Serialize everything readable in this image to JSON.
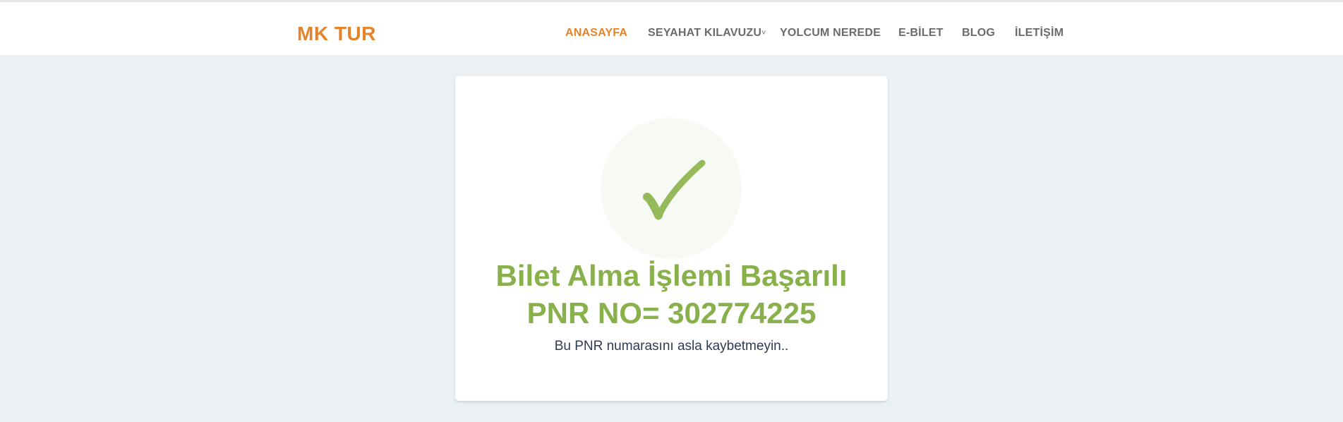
{
  "header": {
    "brand": "MK TUR",
    "nav": [
      {
        "label": "ANASAYFA",
        "active": true
      },
      {
        "label": "SEYAHAT KILAVUZU",
        "has_dropdown": true
      },
      {
        "label": "YOLCUM NEREDE"
      },
      {
        "label": "E-BİLET"
      },
      {
        "label": "BLOG"
      },
      {
        "label": "İLETİŞİM"
      }
    ]
  },
  "result": {
    "icon": "checkmark-icon",
    "title_line1": "Bilet Alma İşlemi Başarılı",
    "title_line2": "PNR NO= 302774225",
    "message": "Bu PNR numarasını asla kaybetmeyin.."
  },
  "colors": {
    "accent": "#e5832a",
    "success": "#88b04b",
    "background": "#ebf0f5"
  }
}
